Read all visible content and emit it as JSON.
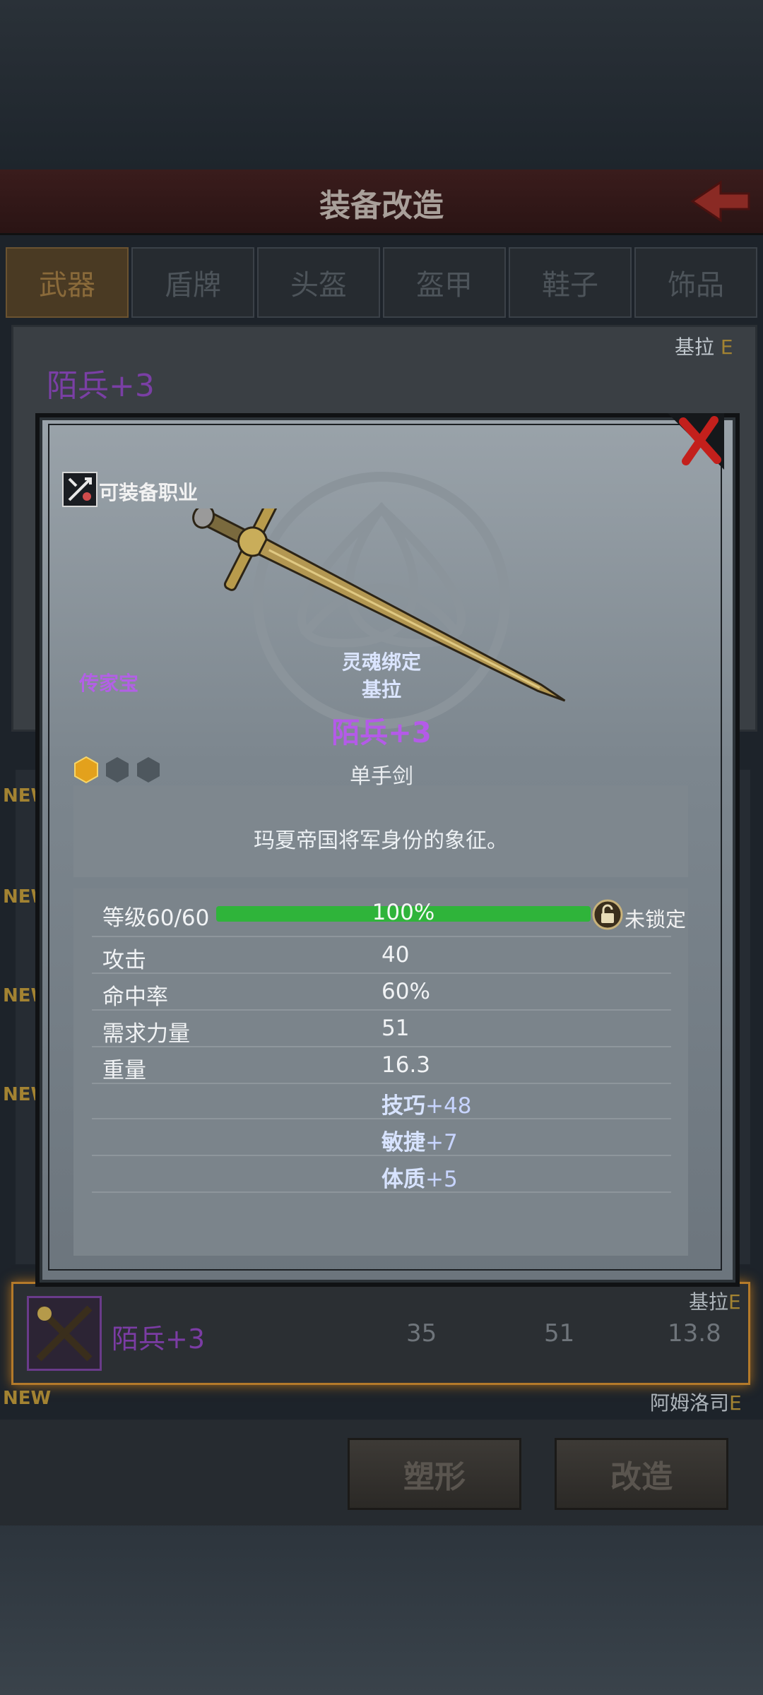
{
  "header": {
    "title": "装备改造"
  },
  "tabs": [
    {
      "label": "武器",
      "active": true
    },
    {
      "label": "盾牌",
      "active": false
    },
    {
      "label": "头盔",
      "active": false
    },
    {
      "label": "盔甲",
      "active": false
    },
    {
      "label": "鞋子",
      "active": false
    },
    {
      "label": "饰品",
      "active": false
    }
  ],
  "background": {
    "item_name": "陌兵+3",
    "owner": "基拉",
    "owner_grade": "E",
    "new_tag": "NEW",
    "selected_row": {
      "name": "陌兵+3",
      "val1": "35",
      "val2": "51",
      "val3": "13.8",
      "owner": "基拉",
      "owner_grade": "E"
    },
    "row2": {
      "owner": "阿姆洛司",
      "owner_grade": "E",
      "new_tag": "NEW"
    }
  },
  "buttons": {
    "shape": "塑形",
    "modify": "改造"
  },
  "modal": {
    "class_label": "可装备职业",
    "heirloom": "传家宝",
    "soulbound": "灵魂绑定",
    "owner": "基拉",
    "item_name": "陌兵+3",
    "item_type": "单手剑",
    "description": "玛夏帝国将军身份的象征。",
    "level_label": "等级60/60",
    "level_percent_text": "100%",
    "level_fraction": 1.0,
    "lock_label": "未锁定",
    "gems": {
      "filled": 1,
      "total": 3
    },
    "stats": [
      {
        "label": "攻击",
        "value": "40"
      },
      {
        "label": "命中率",
        "value": "60%"
      },
      {
        "label": "需求力量",
        "value": "51"
      },
      {
        "label": "重量",
        "value": "16.3"
      }
    ],
    "bonuses": [
      {
        "stat": "技巧",
        "amount": "+48"
      },
      {
        "stat": "敏捷",
        "amount": "+7"
      },
      {
        "stat": "体质",
        "amount": "+5"
      }
    ]
  },
  "colors": {
    "accent_purple": "#b45be8",
    "level_bar": "#2fb43a",
    "selected_border": "#b47a2a"
  }
}
